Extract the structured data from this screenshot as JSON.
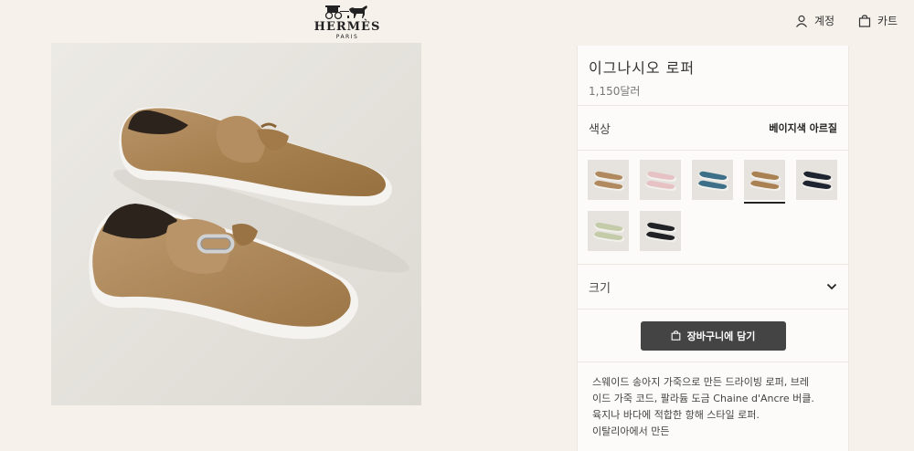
{
  "header": {
    "logo_text": "HERMÈS",
    "logo_subtext": "PARIS",
    "account_label": "계정",
    "cart_label": "카트",
    "account_icon": "user-icon",
    "cart_icon": "bag-icon"
  },
  "product": {
    "name": "이그나시오 로퍼",
    "price": "1,150달러",
    "color_label": "색상",
    "color_value": "베이지색 아르질",
    "size_label": "크기",
    "add_to_cart": "장바구니에 담기",
    "description": [
      "스웨이드 송아지 가죽으로 만든 드라이빙 로퍼, 브레",
      "이드 가죽 코드, 팔라듐 도금 Chaine d'Ancre 버클.",
      "육지나 바다에 적합한 항해 스타일 로퍼.",
      "이탈리아에서 만든"
    ]
  },
  "swatches": [
    {
      "name": "camel",
      "color": "#b08a5e",
      "sole": "#f2f0ec"
    },
    {
      "name": "pink",
      "color": "#e6c2c4",
      "sole": "#f2f0ec"
    },
    {
      "name": "blue",
      "color": "#3d7088",
      "sole": "#f2f0ec"
    },
    {
      "name": "beige",
      "color": "#a98153",
      "sole": "#f2f0ec",
      "selected": true
    },
    {
      "name": "navy",
      "color": "#1e2430",
      "sole": "#f2f0ec"
    },
    {
      "name": "sage",
      "color": "#c3cba8",
      "sole": "#f2f0ec"
    },
    {
      "name": "black",
      "color": "#202226",
      "sole": "#f2f0ec"
    }
  ],
  "colors": {
    "accent": "#444444",
    "background": "#f6f1eb",
    "panel": "#fcfbf9"
  }
}
